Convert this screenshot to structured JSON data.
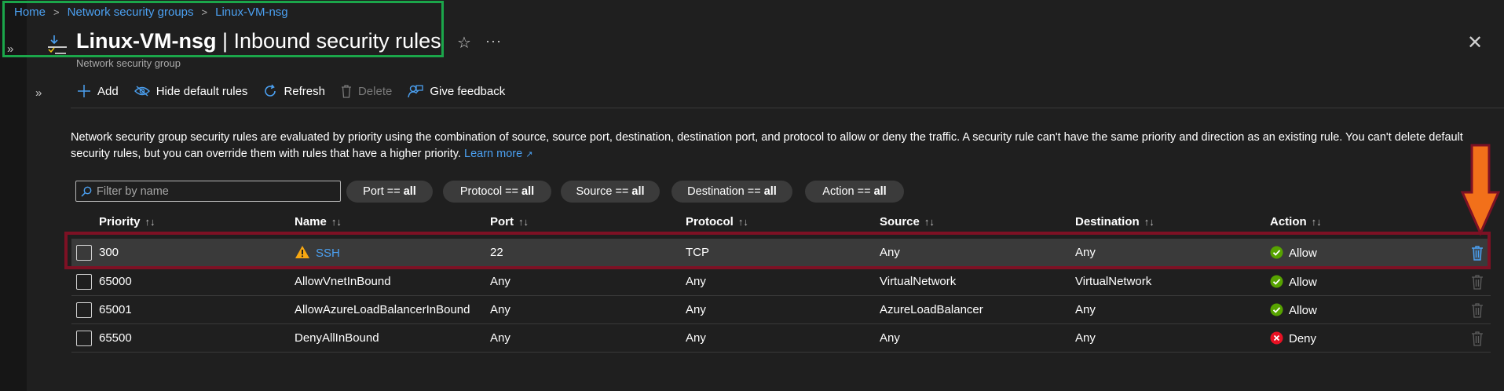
{
  "breadcrumb": [
    "Home",
    "Network security groups",
    "Linux-VM-nsg"
  ],
  "header": {
    "title_bold": "Linux-VM-nsg",
    "title_rest": " | Inbound security rules",
    "subtitle": "Network security group",
    "icons": [
      "download-icon",
      "star-icon",
      "more-icon",
      "close-icon"
    ]
  },
  "toolbar": {
    "add": "Add",
    "hide_default": "Hide default rules",
    "refresh": "Refresh",
    "delete": "Delete",
    "feedback": "Give feedback"
  },
  "info": {
    "text": "Network security group security rules are evaluated by priority using the combination of source, source port, destination, destination port, and protocol to allow or deny the traffic. A security rule can't have the same priority and direction as an existing rule. You can't delete default security rules, but you can override them with rules that have a higher priority.",
    "link": "Learn more"
  },
  "filter": {
    "placeholder": "Filter by name",
    "pills": [
      {
        "label": "Port ==",
        "value": "all"
      },
      {
        "label": "Protocol ==",
        "value": "all"
      },
      {
        "label": "Source ==",
        "value": "all"
      },
      {
        "label": "Destination ==",
        "value": "all"
      },
      {
        "label": "Action ==",
        "value": "all"
      }
    ]
  },
  "table": {
    "columns": [
      "Priority",
      "Name",
      "Port",
      "Protocol",
      "Source",
      "Destination",
      "Action"
    ],
    "rows": [
      {
        "priority": "300",
        "name": "SSH",
        "warning": true,
        "port": "22",
        "protocol": "TCP",
        "source": "Any",
        "destination": "Any",
        "action": "Allow",
        "selected": true
      },
      {
        "priority": "65000",
        "name": "AllowVnetInBound",
        "warning": false,
        "port": "Any",
        "protocol": "Any",
        "source": "VirtualNetwork",
        "destination": "VirtualNetwork",
        "action": "Allow",
        "selected": false
      },
      {
        "priority": "65001",
        "name": "AllowAzureLoadBalancerInBound",
        "warning": false,
        "port": "Any",
        "protocol": "Any",
        "source": "AzureLoadBalancer",
        "destination": "Any",
        "action": "Allow",
        "selected": false
      },
      {
        "priority": "65500",
        "name": "DenyAllInBound",
        "warning": false,
        "port": "Any",
        "protocol": "Any",
        "source": "Any",
        "destination": "Any",
        "action": "Deny",
        "selected": false
      }
    ]
  },
  "colors": {
    "accent": "#4ba0f1",
    "allow": "#57a300",
    "deny": "#e81123",
    "annotation_box_title": "#1ba64a",
    "annotation_box_row": "#7d1124",
    "annotation_arrow": "#f2701a"
  }
}
